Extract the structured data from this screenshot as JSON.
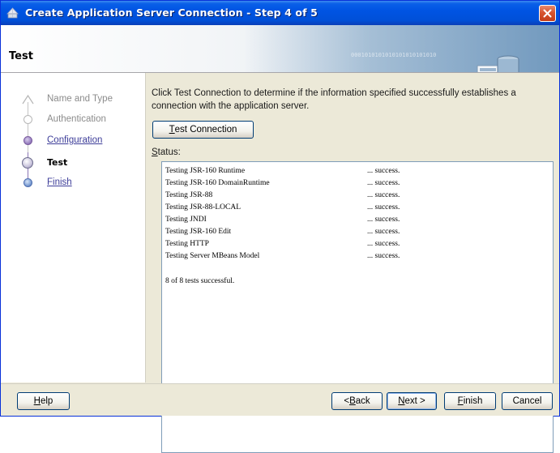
{
  "window": {
    "title": "Create Application Server Connection - Step 4 of 5"
  },
  "header": {
    "page_title": "Test",
    "decor_binary": "0001010101010101010101010"
  },
  "steps": [
    {
      "label": "Name and Type",
      "state": "done"
    },
    {
      "label": "Authentication",
      "state": "done"
    },
    {
      "label": "Configuration",
      "state": "link"
    },
    {
      "label": "Test",
      "state": "current"
    },
    {
      "label": "Finish",
      "state": "link"
    }
  ],
  "content": {
    "instructions": "Click Test Connection to determine if the information specified successfully establishes a connection with the application server.",
    "test_button": {
      "pre": "",
      "key": "T",
      "post": "est Connection"
    },
    "status_label": {
      "pre": "",
      "key": "S",
      "post": "tatus:"
    },
    "status_lines": [
      {
        "name": "Testing JSR-160 Runtime",
        "result": "... success."
      },
      {
        "name": "Testing JSR-160 DomainRuntime",
        "result": "... success."
      },
      {
        "name": "Testing JSR-88",
        "result": "... success."
      },
      {
        "name": "Testing JSR-88-LOCAL",
        "result": "... success."
      },
      {
        "name": "Testing JNDI",
        "result": "... success."
      },
      {
        "name": "Testing JSR-160 Edit",
        "result": "... success."
      },
      {
        "name": "Testing HTTP",
        "result": "... success."
      },
      {
        "name": "Testing Server MBeans Model",
        "result": "... success."
      }
    ],
    "summary": "8 of 8 tests successful."
  },
  "footer": {
    "help": {
      "pre": "",
      "key": "H",
      "post": "elp"
    },
    "back": {
      "pre": "< ",
      "key": "B",
      "post": "ack"
    },
    "next": {
      "pre": "",
      "key": "N",
      "post": "ext >"
    },
    "finish": {
      "pre": "",
      "key": "F",
      "post": "inish"
    },
    "cancel": {
      "pre": "Cancel",
      "key": "",
      "post": ""
    }
  },
  "colors": {
    "titlebar": "#0054e3",
    "dialog_bg": "#ece9d8",
    "link": "#3d3d99",
    "wizard_node_pending": "#9b84c2"
  }
}
